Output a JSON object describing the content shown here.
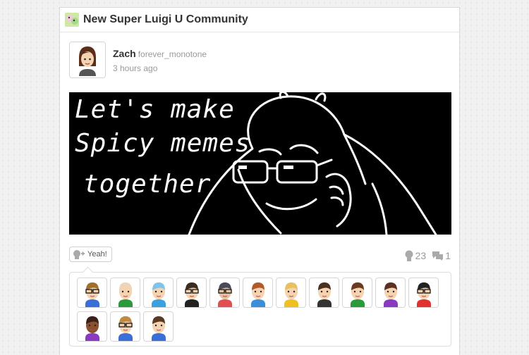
{
  "community": {
    "title": "New Super Luigi U Community",
    "icon": "new-super-luigi-u-community-icon"
  },
  "post": {
    "user_name": "Zach",
    "user_id": "forever_monotone",
    "timestamp": "3 hours ago",
    "drawing_text": [
      "Let's make",
      "Spicy memes",
      "together"
    ]
  },
  "actions": {
    "yeah_label": "Yeah!",
    "yeah_count": "23",
    "comment_count": "1"
  },
  "yeahs": {
    "avatars": [
      {
        "hair": "#a0702a",
        "shirt": "#3a6fd8",
        "skin": "#f5d2b0",
        "glasses": true
      },
      {
        "hair": "#f0d4b8",
        "shirt": "#2a9a3a",
        "skin": "#f5d2b0",
        "glasses": false
      },
      {
        "hair": "#7fc3e8",
        "shirt": "#3aa0e0",
        "skin": "#f5d2b0",
        "glasses": false
      },
      {
        "hair": "#3a2a20",
        "shirt": "#222222",
        "skin": "#f5d2b0",
        "glasses": true
      },
      {
        "hair": "#4a4a5a",
        "shirt": "#e05050",
        "skin": "#e8c0a0",
        "glasses": true
      },
      {
        "hair": "#b05a2a",
        "shirt": "#3a8fd8",
        "skin": "#f5d2b0",
        "glasses": false
      },
      {
        "hair": "#e8c060",
        "shirt": "#f0c020",
        "skin": "#f5d2b0",
        "glasses": false
      },
      {
        "hair": "#4a3020",
        "shirt": "#333333",
        "skin": "#f5d2b0",
        "glasses": false
      },
      {
        "hair": "#6a3a20",
        "shirt": "#2a9a3a",
        "skin": "#f5d2b0",
        "glasses": false
      },
      {
        "hair": "#5a3020",
        "shirt": "#8a3ac0",
        "skin": "#f5d2b0",
        "glasses": false
      },
      {
        "hair": "#222222",
        "shirt": "#e03030",
        "skin": "#f5d2b0",
        "glasses": true
      },
      {
        "hair": "#3a2018",
        "shirt": "#8a3ac0",
        "skin": "#8a5030",
        "glasses": false
      },
      {
        "hair": "#c08a40",
        "shirt": "#3a6fd8",
        "skin": "#f5d2b0",
        "glasses": true
      },
      {
        "hair": "#5a3a20",
        "shirt": "#3a6fd8",
        "skin": "#f5d2b0",
        "glasses": false
      }
    ]
  }
}
